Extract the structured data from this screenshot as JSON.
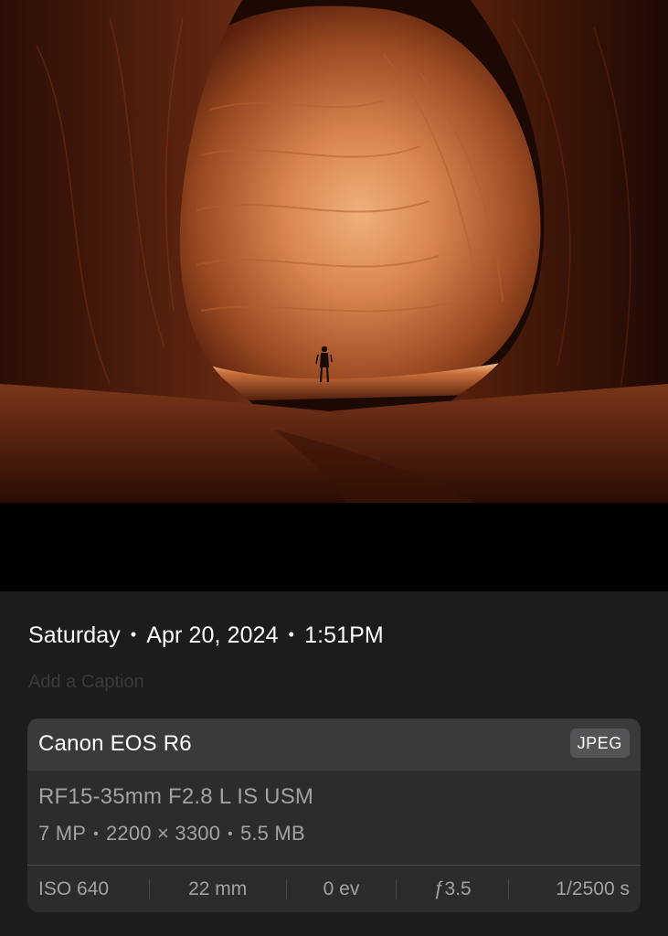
{
  "photo": {
    "subject": "photo-canyon-hiker",
    "colors": {
      "dark_rock": "#1c0904",
      "mid_rock": "#6b2810",
      "lit_rock": "#d9864f",
      "sand": "#f1c49a"
    }
  },
  "info": {
    "date": {
      "day": "Saturday",
      "date": "Apr 20, 2024",
      "time": "1:51PM",
      "separator": "•"
    },
    "caption_placeholder": "Add a Caption"
  },
  "metadata": {
    "camera": "Canon EOS R6",
    "format": "JPEG",
    "lens": "RF15-35mm F2.8 L IS USM",
    "megapixels": "7 MP",
    "dimensions": "2200 × 3300",
    "file_size": "5.5 MB",
    "separator": "•",
    "exposure": {
      "iso": "ISO 640",
      "focal_length": "22 mm",
      "exposure_bias": "0 ev",
      "aperture": "ƒ3.5",
      "shutter": "1/2500 s"
    }
  },
  "colors": {
    "panel_bg": "#1c1c1e",
    "card_bg": "#2c2c2e",
    "card_header_bg": "#3a3a3c",
    "secondary_text": "#a1a1a6",
    "badge_bg": "#545458"
  }
}
